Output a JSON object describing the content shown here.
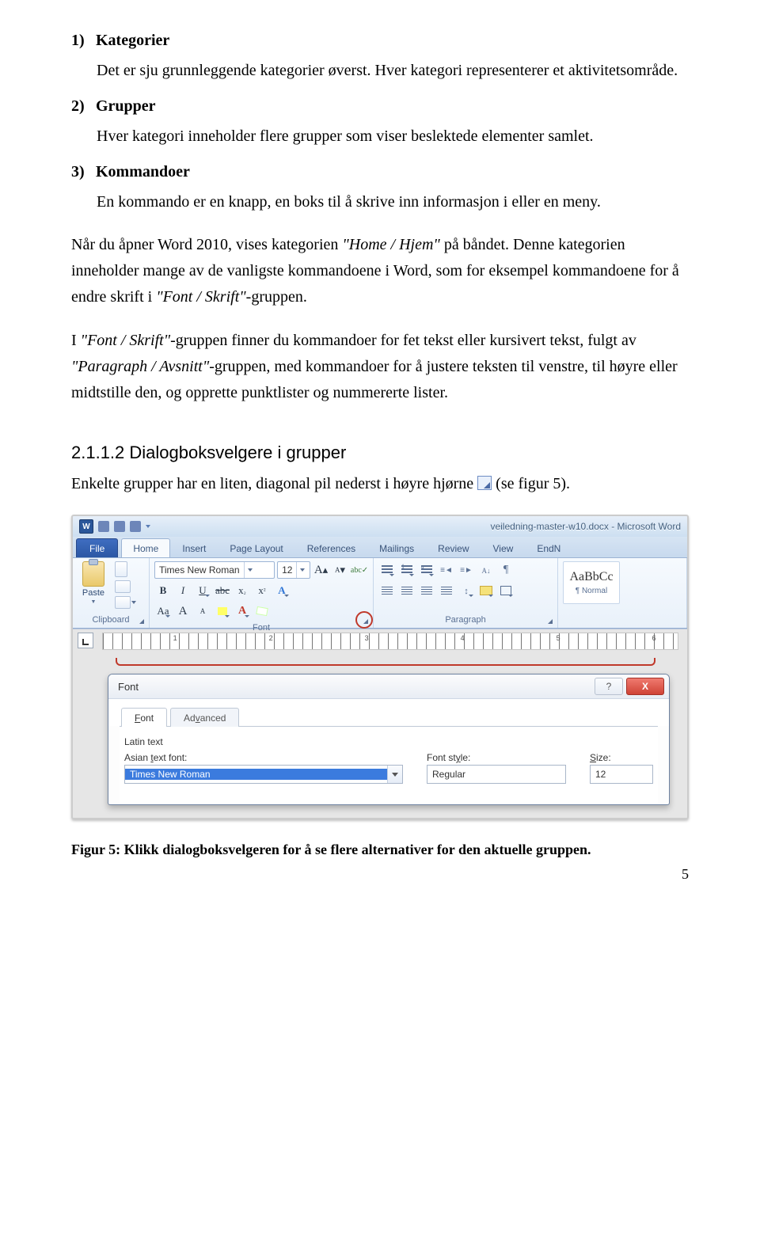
{
  "list": {
    "i1": {
      "num": "1)",
      "title": "Kategorier",
      "body": "Det er sju grunnleggende kategorier øverst. Hver kategori representerer et aktivitetsområde."
    },
    "i2": {
      "num": "2)",
      "title": "Grupper",
      "body": "Hver kategori inneholder flere grupper som viser beslektede elementer samlet."
    },
    "i3": {
      "num": "3)",
      "title": "Kommandoer",
      "body": "En kommando er en knapp, en boks til å skrive inn informasjon i eller en meny."
    }
  },
  "para1_a": "Når du åpner Word 2010, vises kategorien ",
  "para1_i1": "\"Home / Hjem\"",
  "para1_b": " på båndet. Denne kategorien inneholder mange av de vanligste kommandoene i Word, som for eksempel kommandoene for å endre skrift i ",
  "para1_i2": "\"Font / Skrift\"",
  "para1_c": "-gruppen.",
  "para2_a": "I ",
  "para2_i1": "\"Font / Skrift\"",
  "para2_b": "-gruppen finner du kommandoer for fet tekst eller kursivert tekst, fulgt av ",
  "para2_i2": "\"Paragraph / Avsnitt\"",
  "para2_c": "-gruppen, med kommandoer for å justere teksten til venstre, til høyre eller midtstille den, og opprette punktlister og nummererte lister.",
  "section_h": "2.1.1.2  Dialogboksvelgere i grupper",
  "section_p_a": "Enkelte grupper har en liten, diagonal pil nederst i høyre hjørne ",
  "section_p_b": " (se figur 5).",
  "caption": "Figur 5: Klikk dialogboksvelgeren for å se flere alternativer for den aktuelle gruppen.",
  "page_num": "5",
  "word": {
    "title": "veiledning-master-w10.docx - Microsoft Word",
    "tabs": {
      "file": "File",
      "home": "Home",
      "insert": "Insert",
      "pagelayout": "Page Layout",
      "references": "References",
      "mailings": "Mailings",
      "review": "Review",
      "view": "View",
      "endnote": "EndN"
    },
    "paste": "Paste",
    "group_clipboard": "Clipboard",
    "group_font": "Font",
    "group_paragraph": "Paragraph",
    "font_name": "Times New Roman",
    "font_size": "12",
    "style_preview": "AaBbCc",
    "style_name": "¶ Normal",
    "ruler": [
      "",
      "1",
      "",
      "2",
      "",
      "3",
      "",
      "4",
      "",
      "5",
      "",
      "6"
    ]
  },
  "dlg": {
    "title": "Font",
    "tab_font": "Font",
    "tab_adv": "Advanced",
    "group": "Latin text",
    "asian_label_a": "Asian ",
    "asian_label_u": "t",
    "asian_label_b": "ext font:",
    "style_label_a": "Font st",
    "style_label_u": "y",
    "style_label_b": "le:",
    "size_label_u": "S",
    "size_label_a": "ize:",
    "asian_val": "Times New Roman",
    "style_val": "Regular",
    "size_val": "12",
    "help": "?",
    "close": "X"
  }
}
